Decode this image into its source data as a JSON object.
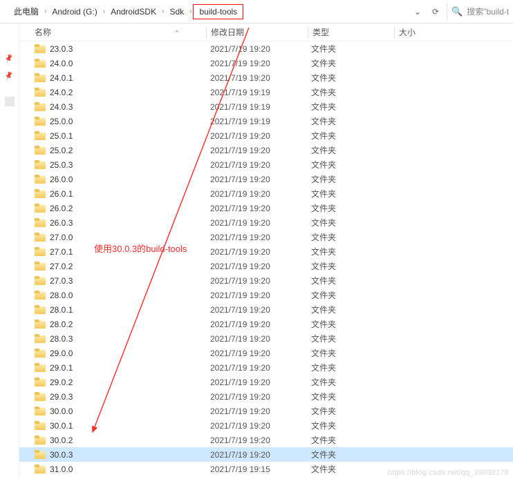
{
  "breadcrumb": {
    "items": [
      "此电脑",
      "Android (G:)",
      "AndroidSDK",
      "Sdk",
      "build-tools"
    ]
  },
  "toolbar": {
    "dropdown_glyph": "⌄",
    "refresh_glyph": "⟳"
  },
  "search": {
    "icon": "🔍",
    "placeholder": "搜索\"build-t"
  },
  "columns": {
    "name": "名称",
    "date": "修改日期",
    "type": "类型",
    "size": "大小",
    "sort_glyph": "^"
  },
  "type_label": "文件夹",
  "rows": [
    {
      "name": "23.0.3",
      "date": "2021/7/19 19:20"
    },
    {
      "name": "24.0.0",
      "date": "2021/7/19 19:20"
    },
    {
      "name": "24.0.1",
      "date": "2021/7/19 19:20"
    },
    {
      "name": "24.0.2",
      "date": "2021/7/19 19:19"
    },
    {
      "name": "24.0.3",
      "date": "2021/7/19 19:19"
    },
    {
      "name": "25.0.0",
      "date": "2021/7/19 19:19"
    },
    {
      "name": "25.0.1",
      "date": "2021/7/19 19:20"
    },
    {
      "name": "25.0.2",
      "date": "2021/7/19 19:20"
    },
    {
      "name": "25.0.3",
      "date": "2021/7/19 19:20"
    },
    {
      "name": "26.0.0",
      "date": "2021/7/19 19:20"
    },
    {
      "name": "26.0.1",
      "date": "2021/7/19 19:20"
    },
    {
      "name": "26.0.2",
      "date": "2021/7/19 19:20"
    },
    {
      "name": "26.0.3",
      "date": "2021/7/19 19:20"
    },
    {
      "name": "27.0.0",
      "date": "2021/7/19 19:20"
    },
    {
      "name": "27.0.1",
      "date": "2021/7/19 19:20"
    },
    {
      "name": "27.0.2",
      "date": "2021/7/19 19:20"
    },
    {
      "name": "27.0.3",
      "date": "2021/7/19 19:20"
    },
    {
      "name": "28.0.0",
      "date": "2021/7/19 19:20"
    },
    {
      "name": "28.0.1",
      "date": "2021/7/19 19:20"
    },
    {
      "name": "28.0.2",
      "date": "2021/7/19 19:20"
    },
    {
      "name": "28.0.3",
      "date": "2021/7/19 19:20"
    },
    {
      "name": "29.0.0",
      "date": "2021/7/19 19:20"
    },
    {
      "name": "29.0.1",
      "date": "2021/7/19 19:20"
    },
    {
      "name": "29.0.2",
      "date": "2021/7/19 19:20"
    },
    {
      "name": "29.0.3",
      "date": "2021/7/19 19:20"
    },
    {
      "name": "30.0.0",
      "date": "2021/7/19 19:20"
    },
    {
      "name": "30.0.1",
      "date": "2021/7/19 19:20"
    },
    {
      "name": "30.0.2",
      "date": "2021/7/19 19:20"
    },
    {
      "name": "30.0.3",
      "date": "2021/7/19 19:20",
      "selected": true
    },
    {
      "name": "31.0.0",
      "date": "2021/7/19 19:15"
    }
  ],
  "annotation": "使用30.0.3的build-tools",
  "watermark": "https://blog.csdn.net/qq_39038178"
}
